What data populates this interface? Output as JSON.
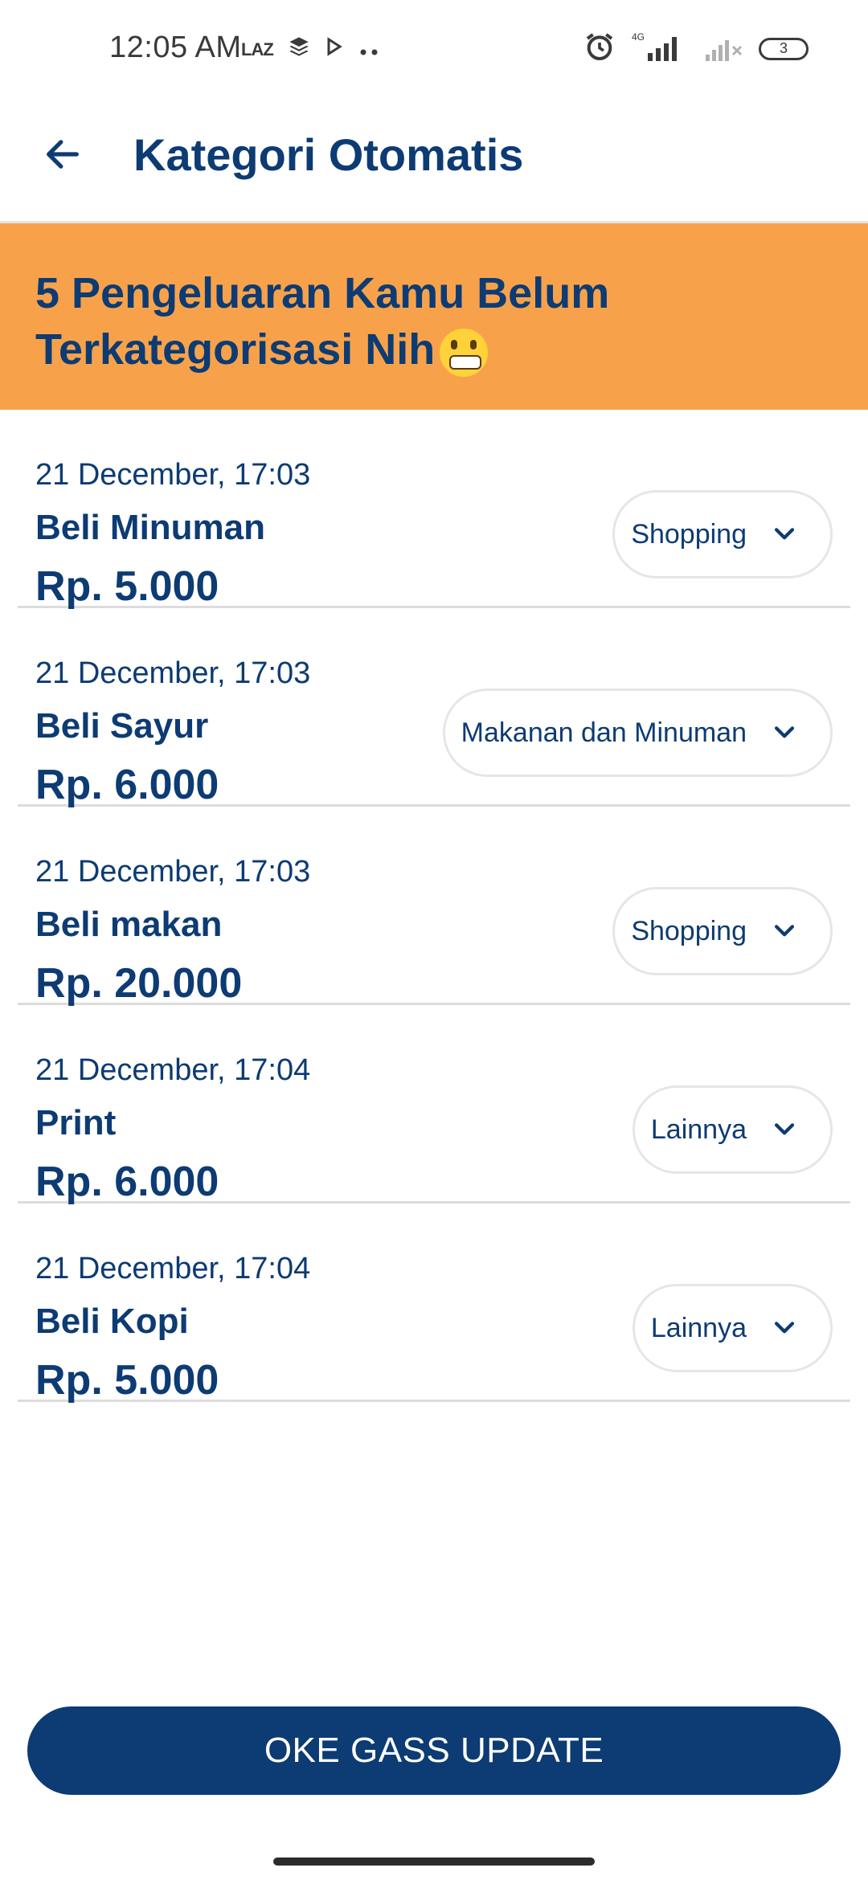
{
  "status_bar": {
    "time": "12:05 AM",
    "left_badge": "LAZ",
    "network": "4G",
    "battery": "3"
  },
  "app_bar": {
    "title": "Kategori Otomatis"
  },
  "banner": {
    "text": "5 Pengeluaran Kamu Belum\n Terkategorisasi Nih",
    "emoji_icon": "grimacing-face-emoji"
  },
  "transactions": [
    {
      "date": "21 December, 17:03",
      "name": "Beli Minuman",
      "amount": "Rp. 5.000",
      "category": "Shopping"
    },
    {
      "date": "21 December, 17:03",
      "name": "Beli Sayur",
      "amount": "Rp. 6.000",
      "category": "Makanan dan Minuman"
    },
    {
      "date": "21 December, 17:03",
      "name": "Beli makan",
      "amount": "Rp. 20.000",
      "category": "Shopping"
    },
    {
      "date": "21 December, 17:04",
      "name": "Print",
      "amount": "Rp. 6.000",
      "category": "Lainnya"
    },
    {
      "date": "21 December, 17:04",
      "name": "Beli Kopi",
      "amount": "Rp. 5.000",
      "category": "Lainnya"
    }
  ],
  "actions": {
    "update_label": "OKE GASS UPDATE"
  },
  "colors": {
    "primary": "#0d3b73",
    "banner": "#f7a24b",
    "divider": "#dcdcdc"
  }
}
